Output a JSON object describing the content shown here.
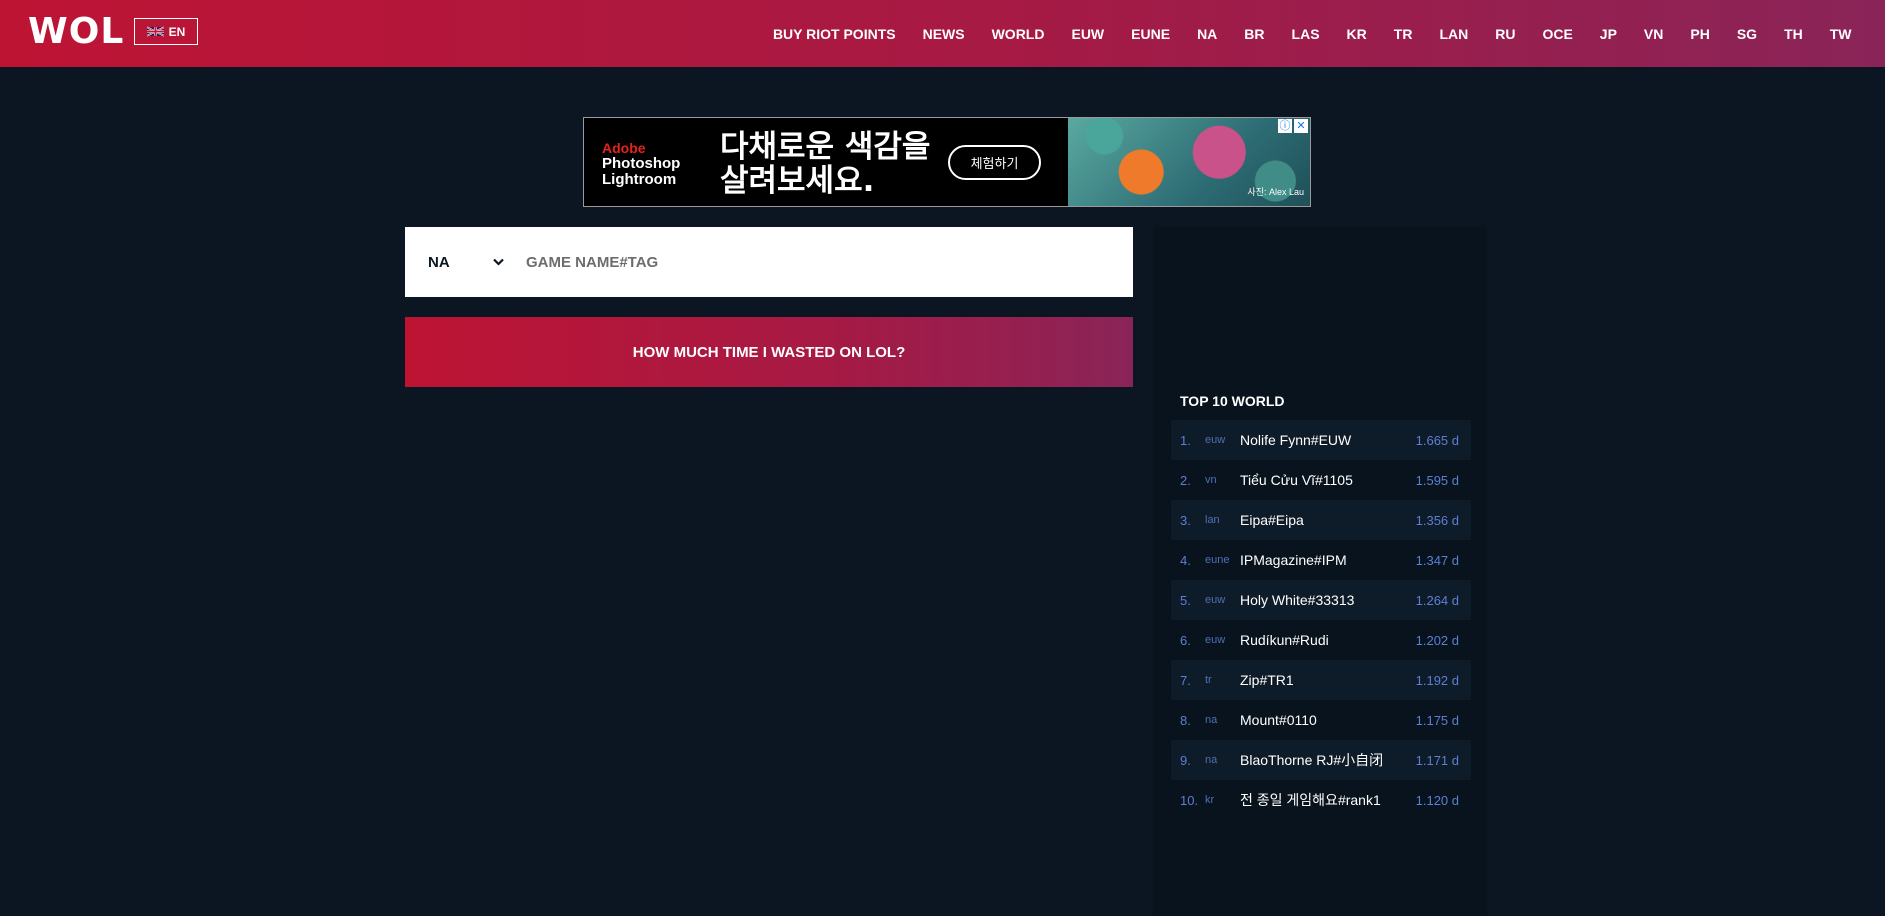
{
  "header": {
    "logo": "WOL",
    "language": "EN",
    "nav": [
      "BUY RIOT POINTS",
      "NEWS",
      "WORLD",
      "EUW",
      "EUNE",
      "NA",
      "BR",
      "LAS",
      "KR",
      "TR",
      "LAN",
      "RU",
      "OCE",
      "JP",
      "VN",
      "PH",
      "SG",
      "TH",
      "TW"
    ]
  },
  "ad": {
    "brand_line1": "Adobe",
    "brand_line2": "Photoshop",
    "brand_line3": "Lightroom",
    "headline_line1": "다채로운 색감을",
    "headline_line2": "살려보세요.",
    "cta": "체험하기",
    "credit": "사진: Alex Lau",
    "info_icon": "ⓘ",
    "close_icon": "✕"
  },
  "search": {
    "region": "NA",
    "placeholder": "GAME NAME#TAG",
    "value": ""
  },
  "submit": {
    "label": "HOW MUCH TIME I WASTED ON LOL?"
  },
  "top10": {
    "title": "TOP 10 WORLD",
    "rows": [
      {
        "rank": "1.",
        "region": "euw",
        "name": "Nolife Fynn#EUW",
        "time": "1.665 d"
      },
      {
        "rank": "2.",
        "region": "vn",
        "name": "Tiểu Cửu Vĩ#1105",
        "time": "1.595 d"
      },
      {
        "rank": "3.",
        "region": "lan",
        "name": "Eipa#Eipa",
        "time": "1.356 d"
      },
      {
        "rank": "4.",
        "region": "eune",
        "name": "IPMagazine#IPM",
        "time": "1.347 d"
      },
      {
        "rank": "5.",
        "region": "euw",
        "name": "Holy White#33313",
        "time": "1.264 d"
      },
      {
        "rank": "6.",
        "region": "euw",
        "name": "Rudíkun#Rudi",
        "time": "1.202 d"
      },
      {
        "rank": "7.",
        "region": "tr",
        "name": "Zip#TR1",
        "time": "1.192 d"
      },
      {
        "rank": "8.",
        "region": "na",
        "name": "Mount#0110",
        "time": "1.175 d"
      },
      {
        "rank": "9.",
        "region": "na",
        "name": "BlaoThorne RJ#小自闭",
        "time": "1.171 d"
      },
      {
        "rank": "10.",
        "region": "kr",
        "name": "전 종일 게임해요#rank1",
        "time": "1.120 d"
      }
    ]
  },
  "colors": {
    "brand_red": "#be1434",
    "brand_purple": "#8a2458",
    "background": "#0b1622",
    "accent_blue": "#5b7fd6"
  }
}
